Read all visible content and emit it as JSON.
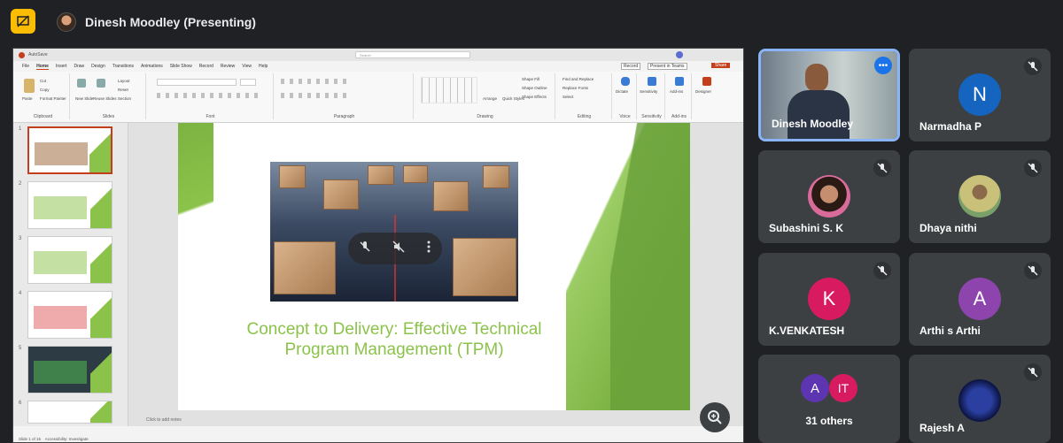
{
  "header": {
    "presenter_label": "Dinesh Moodley (Presenting)"
  },
  "ppt": {
    "menu": [
      "File",
      "Home",
      "Insert",
      "Draw",
      "Design",
      "Transitions",
      "Animations",
      "Slide Show",
      "Record",
      "Review",
      "View",
      "Help"
    ],
    "record_btn": "Record",
    "present_teams_btn": "Present in Teams",
    "share_btn": "Share",
    "search_placeholder": "Search",
    "ribbon_groups": [
      "Clipboard",
      "Slides",
      "Font",
      "Paragraph",
      "Drawing",
      "Editing",
      "Voice",
      "Sensitivity",
      "Add-ins"
    ],
    "ribbon_items": {
      "paste": "Paste",
      "cut": "Cut",
      "copy": "Copy",
      "format_painter": "Format Painter",
      "new_slide": "New Slide",
      "reuse_slides": "Reuse Slides",
      "layout": "Layout",
      "reset": "Reset",
      "section": "Section",
      "arrange": "Arrange",
      "quick_styles": "Quick Styles",
      "shape_fill": "Shape Fill",
      "shape_outline": "Shape Outline",
      "shape_effects": "Shape Effects",
      "find_replace": "Find and Replace",
      "replace_fonts": "Replace Fonts",
      "select": "Select",
      "dictate": "Dictate",
      "sensitivity": "Sensitivity",
      "add_ins": "Add-ins",
      "designer": "Designer"
    },
    "slide_title": "Concept to Delivery: Effective Technical Program Management (TPM)",
    "notes_placeholder": "Click to add notes",
    "status_left": "Slide 1 of 15",
    "status_access": "Accessibility: Investigate",
    "thumb_numbers": [
      "1",
      "2",
      "3",
      "4",
      "5",
      "6"
    ]
  },
  "participants": [
    {
      "name": "Dinesh Moodley",
      "type": "video",
      "muted": false
    },
    {
      "name": "Narmadha P",
      "initial": "N",
      "color": "#1565c0",
      "muted": true
    },
    {
      "name": "Subashini S. K",
      "type": "photo",
      "muted": true
    },
    {
      "name": "Dhaya nithi",
      "type": "photo",
      "muted": true
    },
    {
      "name": "K.VENKATESH",
      "initial": "K",
      "color": "#d81b60",
      "muted": true
    },
    {
      "name": "Arthi s Arthi",
      "initial": "A",
      "color": "#8e44ad",
      "muted": true
    },
    {
      "name": "31 others",
      "initials": [
        "A",
        "IT"
      ],
      "colors": [
        "#5e35b1",
        "#d81b60"
      ]
    },
    {
      "name": "Rajesh A",
      "type": "photo",
      "muted": true
    }
  ]
}
